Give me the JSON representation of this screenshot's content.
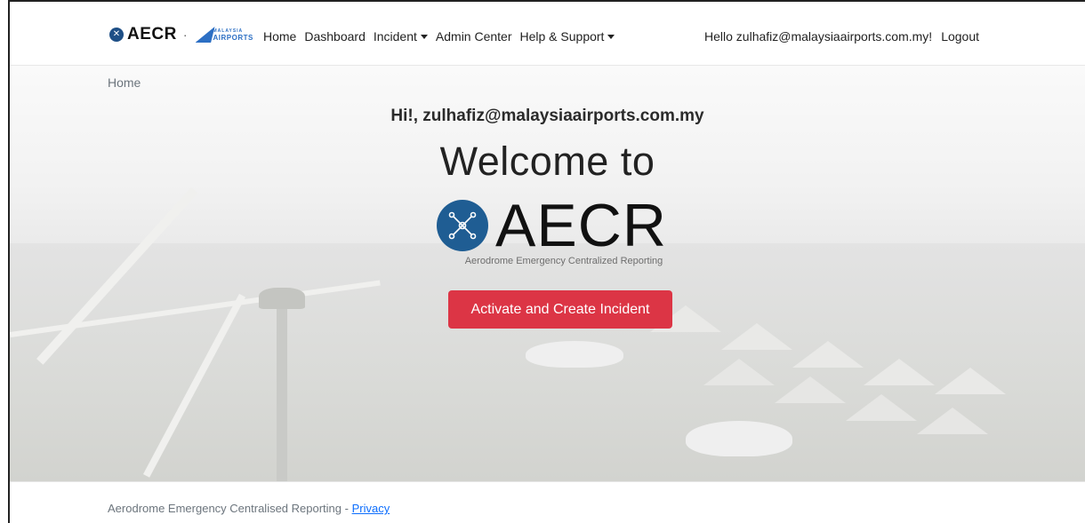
{
  "brand": {
    "name": "AECR",
    "separator": "·",
    "partner_top": "MALAYSIA",
    "partner_bottom": "AIRPORTS"
  },
  "nav": {
    "items": [
      {
        "label": "Home",
        "dropdown": false
      },
      {
        "label": "Dashboard",
        "dropdown": false
      },
      {
        "label": "Incident",
        "dropdown": true
      },
      {
        "label": "Admin Center",
        "dropdown": false
      },
      {
        "label": "Help & Support",
        "dropdown": true
      }
    ],
    "greeting": "Hello zulhafiz@malaysiaairports.com.my!",
    "logout": "Logout"
  },
  "breadcrumb": "Home",
  "hero": {
    "hi": "Hi!, zulhafiz@malaysiaairports.com.my",
    "welcome": "Welcome to",
    "logo_word": "AECR",
    "logo_tagline": "Aerodrome Emergency Centralized Reporting",
    "cta_label": "Activate and Create Incident"
  },
  "footer": {
    "text": "Aerodrome Emergency Centralised Reporting - ",
    "link": "Privacy"
  },
  "colors": {
    "cta": "#dc3545",
    "logo_blue": "#1f5d93",
    "link": "#0d6efd",
    "muted": "#6c757d"
  }
}
